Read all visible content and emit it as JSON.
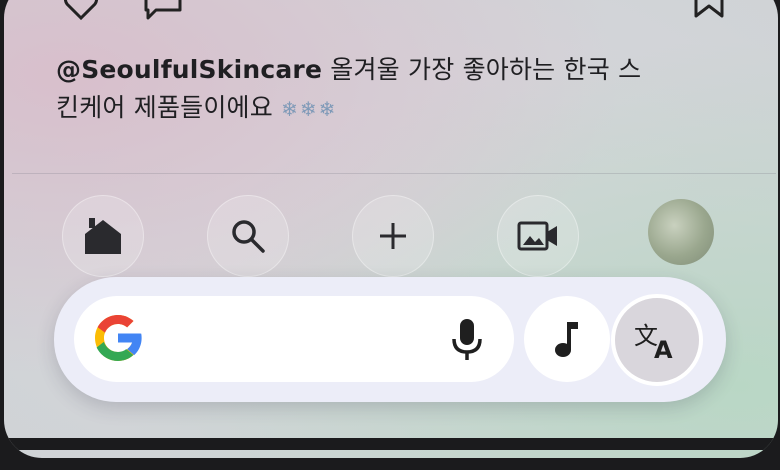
{
  "post": {
    "username": "@SeoulfulSkincare",
    "caption_line1_rest": "올겨울 가장 좋아하는 한국 스",
    "caption_line2": "킨케어 제품들이에요",
    "emojis": "❄❄❄"
  },
  "top_actions": {
    "icons": [
      "heart-icon",
      "comment-icon",
      "bookmark-icon"
    ]
  },
  "bottom_nav": {
    "items": [
      "home-icon",
      "search-icon",
      "create-icon",
      "reels-icon",
      "profile-avatar"
    ]
  },
  "circle_to_search": {
    "search_placeholder": "",
    "buttons": [
      "google-logo",
      "microphone-icon",
      "music-note-icon",
      "translate-icon"
    ],
    "colors": {
      "pill_bg": "#ecedf8",
      "google_blue": "#4285F4",
      "google_red": "#EA4335",
      "google_yellow": "#FBBC05",
      "google_green": "#34A853",
      "translate_bg": "#d9d6dc"
    }
  }
}
